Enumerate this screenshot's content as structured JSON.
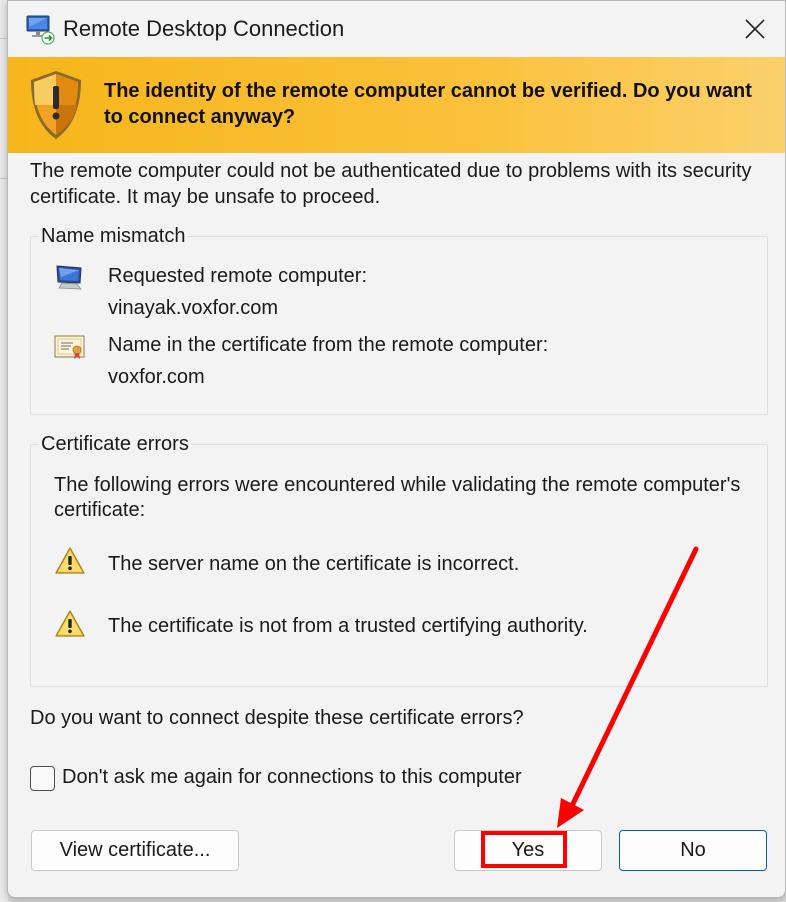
{
  "window": {
    "title": "Remote Desktop Connection",
    "app_icon": "remote-desktop-icon",
    "close_icon": "close-icon"
  },
  "banner": {
    "icon": "security-shield-icon",
    "text": "The identity of the remote computer cannot be verified. Do you want to connect anyway?",
    "color": "#f6b51a"
  },
  "intro": "The remote computer could not be authenticated due to problems with its security certificate. It may be unsafe to proceed.",
  "name_mismatch": {
    "title": "Name mismatch",
    "requested_label": "Requested remote computer:",
    "requested_value": "vinayak.voxfor.com",
    "certificate_label": "Name in the certificate from the remote computer:",
    "certificate_value": "voxfor.com"
  },
  "certificate_errors": {
    "title": "Certificate errors",
    "description": "The following errors were encountered while validating the remote computer's certificate:",
    "errors": [
      "The server name on the certificate is incorrect.",
      "The certificate is not from a trusted certifying authority."
    ]
  },
  "question": "Do you want to connect despite these certificate errors?",
  "checkbox": {
    "label": "Don't ask me again for connections to this computer",
    "checked": false
  },
  "buttons": {
    "view_certificate": "View certificate...",
    "yes": "Yes",
    "no": "No"
  },
  "annotation": {
    "color": "#ff0000",
    "target": "Yes"
  }
}
